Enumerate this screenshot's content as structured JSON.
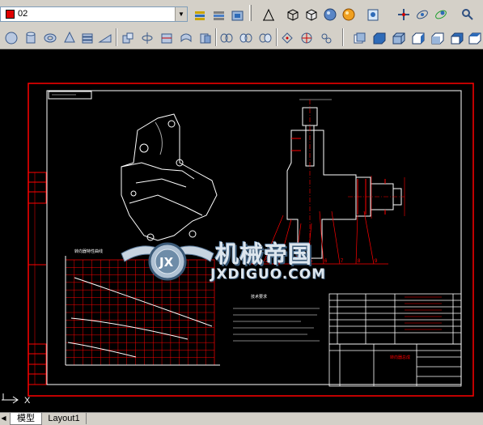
{
  "toolbar_top": {
    "layer_current": "02",
    "icons": [
      "layer-state-icon",
      "layer-previous-icon",
      "layer-tools-icon",
      "dim-angle-icon",
      "box-3d-icon",
      "box-3d-wire-icon",
      "sphere-shaded-icon",
      "sphere-color-icon",
      "paint-icon",
      "orbit-icon",
      "free-orbit-icon",
      "continuous-orbit-icon",
      "help-icon"
    ]
  },
  "toolbar_bottom": {
    "icons": [
      "sphere-icon",
      "cylinder-icon",
      "torus-icon",
      "cone-icon",
      "extrude-icon",
      "wedge-icon",
      "union-icon",
      "revolve-icon",
      "section-icon",
      "slice-icon",
      "interfere-icon",
      "setup-view-icon",
      "setup-drawing-icon",
      "setup-profile-icon",
      "ucs-icon",
      "ucs-world-icon",
      "ucs-origin-icon",
      "view-top-icon",
      "view-bottom-icon",
      "view-left-icon",
      "view-right-icon",
      "view-front-icon",
      "view-back-icon"
    ]
  },
  "drawing": {
    "watermark_title": "机械帝国",
    "watermark_sub": "JXDIGUO.COM",
    "watermark_logo": "JX",
    "title_block_label": "转向器总成",
    "graph_title": "转向器特性曲线",
    "tech_req_title": "技术要求"
  },
  "ucs": {
    "axis_x": "X"
  },
  "tabs": {
    "model": "模型",
    "layout1": "Layout1"
  },
  "colors": {
    "frame": "#ff0000",
    "line": "#ffffff",
    "background": "#000000",
    "toolbar": "#d4d0c8"
  }
}
